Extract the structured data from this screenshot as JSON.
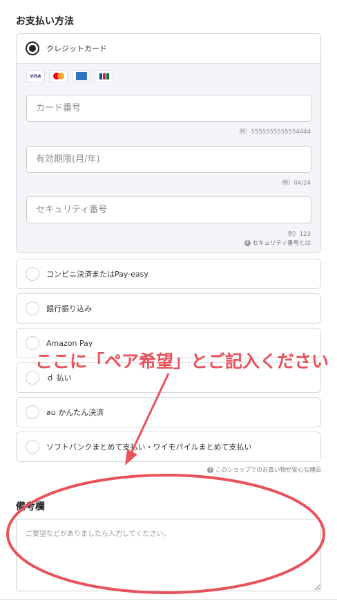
{
  "payment_heading": "お支払い方法",
  "credit_card": {
    "label": "クレジットカード",
    "selected": true,
    "brand_icons": [
      "visa-icon",
      "mastercard-icon",
      "amex-icon",
      "jcb-icon"
    ],
    "visa_text": "VISA",
    "card_number": {
      "placeholder": "カード番号",
      "hint": "例）5555555555554444"
    },
    "expiry": {
      "placeholder": "有効期限(月/年)",
      "hint": "例）04/24"
    },
    "security": {
      "placeholder": "セキュリティ番号",
      "hint": "例）123",
      "help_link": "セキュリティ番号とは"
    }
  },
  "payment_options": [
    {
      "label": "コンビニ決済またはPay-easy",
      "selected": false
    },
    {
      "label": "銀行振り込み",
      "selected": false
    },
    {
      "label": "Amazon Pay",
      "selected": false
    },
    {
      "label": "ｄ 払い",
      "selected": false
    },
    {
      "label": "au かんたん決済",
      "selected": false
    },
    {
      "label": "ソフトバンクまとめて支払い・ワイモバイルまとめて支払い",
      "selected": false
    }
  ],
  "reassurance_link": "このショップでのお買い物が安心な理由",
  "remarks": {
    "heading": "備考欄",
    "placeholder": "ご要望などがありましたら入力してください。",
    "value": ""
  },
  "annotation": {
    "text": "ここに「ペア希望」とご記入ください",
    "color": "#e8525a"
  },
  "colors": {
    "accent": "#e8525a",
    "card_area_bg": "#f4f5f8",
    "border": "#d8d8d8"
  }
}
